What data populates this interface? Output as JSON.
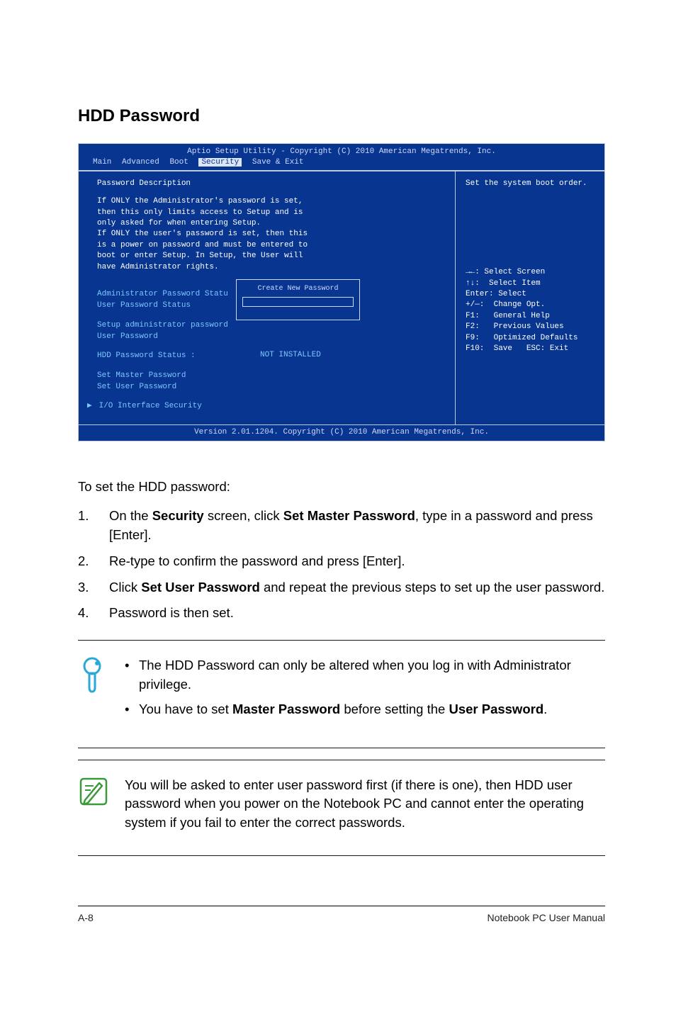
{
  "heading": "HDD Password",
  "bios": {
    "top": "Aptio Setup Utility - Copyright (C) 2010 American Megatrends, Inc.",
    "menu": {
      "main": "Main",
      "advanced": "Advanced",
      "boot": "Boot",
      "security": "Security",
      "save": "Save & Exit"
    },
    "left": {
      "title": "Password Description",
      "desc": "If ONLY the Administrator's password is set,\nthen this only limits access to Setup and is\nonly asked for when entering Setup.\nIf ONLY the user's password is set, then this\nis a power on password and must be entered to\nboot or enter Setup. In Setup, the User will\nhave Administrator rights.",
      "admin_status": "Administrator Password Statu",
      "user_status": "User Password Status",
      "setup_admin": "Setup administrator password",
      "user_pw": "User Password",
      "hdd_label": "HDD Password Status :",
      "hdd_value": "NOT INSTALLED",
      "set_master": "Set Master Password",
      "set_user": "Set User Password",
      "io_sec": "I/O Interface Security",
      "popup_title": "Create New Password"
    },
    "right": {
      "top": "Set the system boot order.",
      "help": [
        "→←: Select Screen",
        "↑↓:  Select Item",
        "Enter: Select",
        "+/—:  Change Opt.",
        "F1:   General Help",
        "F2:   Previous Values",
        "F9:   Optimized Defaults",
        "F10:  Save   ESC: Exit"
      ]
    },
    "bottom": "Version 2.01.1204. Copyright (C) 2010 American Megatrends, Inc."
  },
  "intro": "To set the HDD password:",
  "steps": {
    "s1a": "On the ",
    "s1b": "Security",
    "s1c": " screen, click ",
    "s1d": "Set Master Password",
    "s1e": ", type in a password and press [Enter].",
    "s2": "Re-type to confirm the password and press [Enter].",
    "s3a": "Click ",
    "s3b": "Set User Password",
    "s3c": " and repeat the previous steps to set up the user password.",
    "s4": "Password is then set."
  },
  "tip": {
    "b1": "The HDD Password can only be altered when you log in with Administrator privilege.",
    "b2a": "You have to set ",
    "b2b": "Master Password",
    "b2c": " before setting the ",
    "b2d": "User Password",
    "b2e": "."
  },
  "note": "You will be asked to enter user password first (if there is one), then HDD user password when you power on the Notebook PC and cannot enter the operating system if you fail to enter the correct passwords.",
  "footer": {
    "left": "A-8",
    "right": "Notebook PC User Manual"
  }
}
